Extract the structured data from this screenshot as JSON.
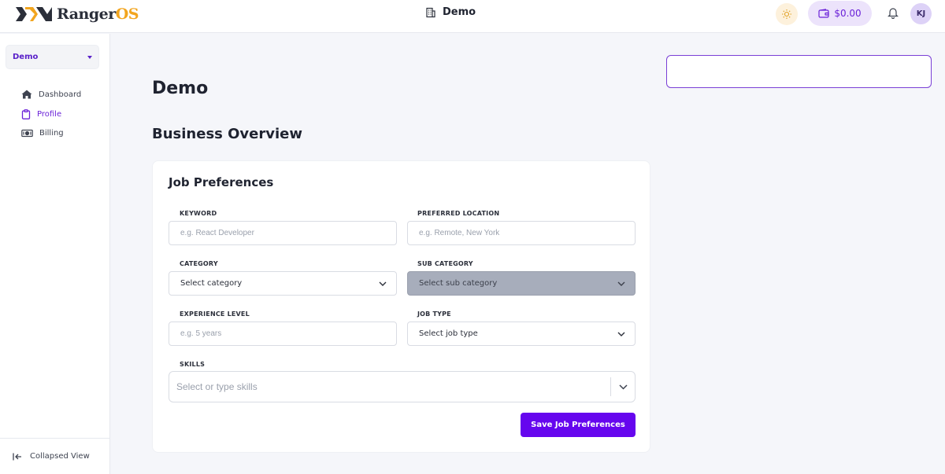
{
  "app": {
    "logo_part1": "Ranger",
    "logo_part2": "OS",
    "brand_color": "#6606ee"
  },
  "header": {
    "workspace_name": "Demo",
    "workspace_icon": "building-icon",
    "theme_icon": "sun-icon",
    "wallet_balance": "$0.00",
    "wallet_icon": "wallet-icon",
    "notification_icon": "bell-icon",
    "avatar_initials": "KJ"
  },
  "sidebar": {
    "workspace_select": "Demo",
    "items": [
      {
        "label": "Dashboard",
        "icon": "home-icon",
        "active": false
      },
      {
        "label": "Profile",
        "icon": "clipboard-icon",
        "active": true
      },
      {
        "label": "Billing",
        "icon": "money-icon",
        "active": false
      }
    ],
    "collapse_label": "Collapsed View"
  },
  "main": {
    "page_title": "Demo",
    "section_title": "Business Overview",
    "card": {
      "title": "Job Preferences",
      "keyword": {
        "label": "KEYWORD",
        "placeholder": "e.g. React Developer"
      },
      "location": {
        "label": "PREFERRED LOCATION",
        "placeholder": "e.g. Remote, New York"
      },
      "category": {
        "label": "CATEGORY",
        "value": "Select category"
      },
      "sub_category": {
        "label": "SUB CATEGORY",
        "value": "Select sub category"
      },
      "experience": {
        "label": "EXPERIENCE LEVEL",
        "placeholder": "e.g. 5 years"
      },
      "job_type": {
        "label": "JOB TYPE",
        "value": "Select job type"
      },
      "skills": {
        "label": "SKILLS",
        "placeholder": "Select or type skills"
      },
      "save_label": "Save Job Preferences"
    }
  }
}
